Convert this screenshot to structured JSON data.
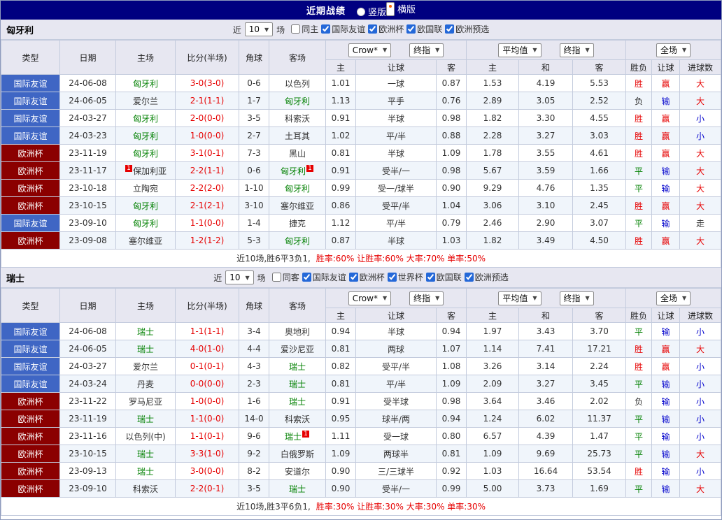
{
  "top_bar": {
    "title": "近期战绩",
    "options": [
      {
        "label": "竖版",
        "selected": false
      },
      {
        "label": "横版",
        "selected": true
      }
    ]
  },
  "table_header": {
    "type": "类型",
    "date": "日期",
    "home": "主场",
    "score": "比分(半场)",
    "corner": "角球",
    "away": "客场",
    "asia_select_1": "Crow*",
    "asia_select_2": "终指",
    "euro_select_1": "平均值",
    "euro_select_2": "终指",
    "scope_select": "全场",
    "asia_home": "主",
    "asia_handicap": "让球",
    "asia_away": "客",
    "euro_home": "主",
    "euro_draw": "和",
    "euro_away": "客",
    "res_outcome": "胜负",
    "res_handicap": "让球",
    "res_goals": "进球数"
  },
  "sections": [
    {
      "team": "匈牙利",
      "filter": {
        "prefix": "近",
        "count": "10",
        "suffix": "场",
        "checkboxes": [
          {
            "label": "同主",
            "checked": false
          },
          {
            "label": "国际友谊",
            "checked": true
          },
          {
            "label": "欧洲杯",
            "checked": true
          },
          {
            "label": "欧国联",
            "checked": true
          },
          {
            "label": "欧洲预选",
            "checked": true
          }
        ]
      },
      "rows": [
        {
          "type": "国际友谊",
          "typeColor": "blue",
          "date": "24-06-08",
          "home": "匈牙利",
          "homeHL": true,
          "homeCard": "",
          "score": "3-0(3-0)",
          "corner": "0-6",
          "away": "以色列",
          "awayHL": false,
          "awayCard": "",
          "asiaHome": "1.01",
          "handicap": "一球",
          "asiaAway": "0.87",
          "euroHome": "1.53",
          "euroDraw": "4.19",
          "euroAway": "5.53",
          "outcome": "胜",
          "outcomeC": "r",
          "letBall": "赢",
          "letBallC": "r",
          "goals": "大",
          "goalsC": "r"
        },
        {
          "type": "国际友谊",
          "typeColor": "blue",
          "date": "24-06-05",
          "home": "爱尔兰",
          "homeHL": false,
          "homeCard": "",
          "score": "2-1(1-1)",
          "corner": "1-7",
          "away": "匈牙利",
          "awayHL": true,
          "awayCard": "",
          "asiaHome": "1.13",
          "handicap": "平手",
          "asiaAway": "0.76",
          "euroHome": "2.89",
          "euroDraw": "3.05",
          "euroAway": "2.52",
          "outcome": "负",
          "outcomeC": "k",
          "letBall": "输",
          "letBallC": "b",
          "goals": "大",
          "goalsC": "r"
        },
        {
          "type": "国际友谊",
          "typeColor": "blue",
          "date": "24-03-27",
          "home": "匈牙利",
          "homeHL": true,
          "homeCard": "",
          "score": "2-0(0-0)",
          "corner": "3-5",
          "away": "科索沃",
          "awayHL": false,
          "awayCard": "",
          "asiaHome": "0.91",
          "handicap": "半球",
          "asiaAway": "0.98",
          "euroHome": "1.82",
          "euroDraw": "3.30",
          "euroAway": "4.55",
          "outcome": "胜",
          "outcomeC": "r",
          "letBall": "赢",
          "letBallC": "r",
          "goals": "小",
          "goalsC": "b"
        },
        {
          "type": "国际友谊",
          "typeColor": "blue",
          "date": "24-03-23",
          "home": "匈牙利",
          "homeHL": true,
          "homeCard": "",
          "score": "1-0(0-0)",
          "corner": "2-7",
          "away": "土耳其",
          "awayHL": false,
          "awayCard": "",
          "asiaHome": "1.02",
          "handicap": "平/半",
          "asiaAway": "0.88",
          "euroHome": "2.28",
          "euroDraw": "3.27",
          "euroAway": "3.03",
          "outcome": "胜",
          "outcomeC": "r",
          "letBall": "赢",
          "letBallC": "r",
          "goals": "小",
          "goalsC": "b"
        },
        {
          "type": "欧洲杯",
          "typeColor": "red",
          "date": "23-11-19",
          "home": "匈牙利",
          "homeHL": true,
          "homeCard": "",
          "score": "3-1(0-1)",
          "corner": "7-3",
          "away": "黑山",
          "awayHL": false,
          "awayCard": "",
          "asiaHome": "0.81",
          "handicap": "半球",
          "asiaAway": "1.09",
          "euroHome": "1.78",
          "euroDraw": "3.55",
          "euroAway": "4.61",
          "outcome": "胜",
          "outcomeC": "r",
          "letBall": "赢",
          "letBallC": "r",
          "goals": "大",
          "goalsC": "r"
        },
        {
          "type": "欧洲杯",
          "typeColor": "red",
          "date": "23-11-17",
          "home": "保加利亚",
          "homeHL": false,
          "homeCard": "1",
          "score": "2-2(1-1)",
          "corner": "0-6",
          "away": "匈牙利",
          "awayHL": true,
          "awayCard": "1",
          "asiaHome": "0.91",
          "handicap": "受半/一",
          "asiaAway": "0.98",
          "euroHome": "5.67",
          "euroDraw": "3.59",
          "euroAway": "1.66",
          "outcome": "平",
          "outcomeC": "g",
          "letBall": "输",
          "letBallC": "b",
          "goals": "大",
          "goalsC": "r"
        },
        {
          "type": "欧洲杯",
          "typeColor": "red",
          "date": "23-10-18",
          "home": "立陶宛",
          "homeHL": false,
          "homeCard": "",
          "score": "2-2(2-0)",
          "corner": "1-10",
          "away": "匈牙利",
          "awayHL": true,
          "awayCard": "",
          "asiaHome": "0.99",
          "handicap": "受一/球半",
          "asiaAway": "0.90",
          "euroHome": "9.29",
          "euroDraw": "4.76",
          "euroAway": "1.35",
          "outcome": "平",
          "outcomeC": "g",
          "letBall": "输",
          "letBallC": "b",
          "goals": "大",
          "goalsC": "r"
        },
        {
          "type": "欧洲杯",
          "typeColor": "red",
          "date": "23-10-15",
          "home": "匈牙利",
          "homeHL": true,
          "homeCard": "",
          "score": "2-1(2-1)",
          "corner": "3-10",
          "away": "塞尔维亚",
          "awayHL": false,
          "awayCard": "",
          "asiaHome": "0.86",
          "handicap": "受平/半",
          "asiaAway": "1.04",
          "euroHome": "3.06",
          "euroDraw": "3.10",
          "euroAway": "2.45",
          "outcome": "胜",
          "outcomeC": "r",
          "letBall": "赢",
          "letBallC": "r",
          "goals": "大",
          "goalsC": "r"
        },
        {
          "type": "国际友谊",
          "typeColor": "blue",
          "date": "23-09-10",
          "home": "匈牙利",
          "homeHL": true,
          "homeCard": "",
          "score": "1-1(0-0)",
          "corner": "1-4",
          "away": "捷克",
          "awayHL": false,
          "awayCard": "",
          "asiaHome": "1.12",
          "handicap": "平/半",
          "asiaAway": "0.79",
          "euroHome": "2.46",
          "euroDraw": "2.90",
          "euroAway": "3.07",
          "outcome": "平",
          "outcomeC": "g",
          "letBall": "输",
          "letBallC": "b",
          "goals": "走",
          "goalsC": "k"
        },
        {
          "type": "欧洲杯",
          "typeColor": "red",
          "date": "23-09-08",
          "home": "塞尔维亚",
          "homeHL": false,
          "homeCard": "",
          "score": "1-2(1-2)",
          "corner": "5-3",
          "away": "匈牙利",
          "awayHL": true,
          "awayCard": "",
          "asiaHome": "0.87",
          "handicap": "半球",
          "asiaAway": "1.03",
          "euroHome": "1.82",
          "euroDraw": "3.49",
          "euroAway": "4.50",
          "outcome": "胜",
          "outcomeC": "r",
          "letBall": "赢",
          "letBallC": "r",
          "goals": "大",
          "goalsC": "r"
        }
      ],
      "summary": {
        "prefix": "近10场,胜6平3负1,",
        "stats": "胜率:60% 让胜率:60% 大率:70% 单率:50%"
      }
    },
    {
      "team": "瑞士",
      "filter": {
        "prefix": "近",
        "count": "10",
        "suffix": "场",
        "checkboxes": [
          {
            "label": "同客",
            "checked": false
          },
          {
            "label": "国际友谊",
            "checked": true
          },
          {
            "label": "欧洲杯",
            "checked": true
          },
          {
            "label": "世界杯",
            "checked": true
          },
          {
            "label": "欧国联",
            "checked": true
          },
          {
            "label": "欧洲预选",
            "checked": true
          }
        ]
      },
      "rows": [
        {
          "type": "国际友谊",
          "typeColor": "blue",
          "date": "24-06-08",
          "home": "瑞士",
          "homeHL": true,
          "homeCard": "",
          "score": "1-1(1-1)",
          "corner": "3-4",
          "away": "奥地利",
          "awayHL": false,
          "awayCard": "",
          "asiaHome": "0.94",
          "handicap": "半球",
          "asiaAway": "0.94",
          "euroHome": "1.97",
          "euroDraw": "3.43",
          "euroAway": "3.70",
          "outcome": "平",
          "outcomeC": "g",
          "letBall": "输",
          "letBallC": "b",
          "goals": "小",
          "goalsC": "b"
        },
        {
          "type": "国际友谊",
          "typeColor": "blue",
          "date": "24-06-05",
          "home": "瑞士",
          "homeHL": true,
          "homeCard": "",
          "score": "4-0(1-0)",
          "corner": "4-4",
          "away": "爱沙尼亚",
          "awayHL": false,
          "awayCard": "",
          "asiaHome": "0.81",
          "handicap": "两球",
          "asiaAway": "1.07",
          "euroHome": "1.14",
          "euroDraw": "7.41",
          "euroAway": "17.21",
          "outcome": "胜",
          "outcomeC": "r",
          "letBall": "赢",
          "letBallC": "r",
          "goals": "大",
          "goalsC": "r"
        },
        {
          "type": "国际友谊",
          "typeColor": "blue",
          "date": "24-03-27",
          "home": "爱尔兰",
          "homeHL": false,
          "homeCard": "",
          "score": "0-1(0-1)",
          "corner": "4-3",
          "away": "瑞士",
          "awayHL": true,
          "awayCard": "",
          "asiaHome": "0.82",
          "handicap": "受平/半",
          "asiaAway": "1.08",
          "euroHome": "3.26",
          "euroDraw": "3.14",
          "euroAway": "2.24",
          "outcome": "胜",
          "outcomeC": "r",
          "letBall": "赢",
          "letBallC": "r",
          "goals": "小",
          "goalsC": "b"
        },
        {
          "type": "国际友谊",
          "typeColor": "blue",
          "date": "24-03-24",
          "home": "丹麦",
          "homeHL": false,
          "homeCard": "",
          "score": "0-0(0-0)",
          "corner": "2-3",
          "away": "瑞士",
          "awayHL": true,
          "awayCard": "",
          "asiaHome": "0.81",
          "handicap": "平/半",
          "asiaAway": "1.09",
          "euroHome": "2.09",
          "euroDraw": "3.27",
          "euroAway": "3.45",
          "outcome": "平",
          "outcomeC": "g",
          "letBall": "输",
          "letBallC": "b",
          "goals": "小",
          "goalsC": "b"
        },
        {
          "type": "欧洲杯",
          "typeColor": "red",
          "date": "23-11-22",
          "home": "罗马尼亚",
          "homeHL": false,
          "homeCard": "",
          "score": "1-0(0-0)",
          "corner": "1-6",
          "away": "瑞士",
          "awayHL": true,
          "awayCard": "",
          "asiaHome": "0.91",
          "handicap": "受半球",
          "asiaAway": "0.98",
          "euroHome": "3.64",
          "euroDraw": "3.46",
          "euroAway": "2.02",
          "outcome": "负",
          "outcomeC": "k",
          "letBall": "输",
          "letBallC": "b",
          "goals": "小",
          "goalsC": "b"
        },
        {
          "type": "欧洲杯",
          "typeColor": "red",
          "date": "23-11-19",
          "home": "瑞士",
          "homeHL": true,
          "homeCard": "",
          "score": "1-1(0-0)",
          "corner": "14-0",
          "away": "科索沃",
          "awayHL": false,
          "awayCard": "",
          "asiaHome": "0.95",
          "handicap": "球半/两",
          "asiaAway": "0.94",
          "euroHome": "1.24",
          "euroDraw": "6.02",
          "euroAway": "11.37",
          "outcome": "平",
          "outcomeC": "g",
          "letBall": "输",
          "letBallC": "b",
          "goals": "小",
          "goalsC": "b"
        },
        {
          "type": "欧洲杯",
          "typeColor": "red",
          "date": "23-11-16",
          "home": "以色列(中)",
          "homeHL": false,
          "homeCard": "",
          "score": "1-1(0-1)",
          "corner": "9-6",
          "away": "瑞士",
          "awayHL": true,
          "awayCard": "1",
          "asiaHome": "1.11",
          "handicap": "受一球",
          "asiaAway": "0.80",
          "euroHome": "6.57",
          "euroDraw": "4.39",
          "euroAway": "1.47",
          "outcome": "平",
          "outcomeC": "g",
          "letBall": "输",
          "letBallC": "b",
          "goals": "小",
          "goalsC": "b"
        },
        {
          "type": "欧洲杯",
          "typeColor": "red",
          "date": "23-10-15",
          "home": "瑞士",
          "homeHL": true,
          "homeCard": "",
          "score": "3-3(1-0)",
          "corner": "9-2",
          "away": "白俄罗斯",
          "awayHL": false,
          "awayCard": "",
          "asiaHome": "1.09",
          "handicap": "两球半",
          "asiaAway": "0.81",
          "euroHome": "1.09",
          "euroDraw": "9.69",
          "euroAway": "25.73",
          "outcome": "平",
          "outcomeC": "g",
          "letBall": "输",
          "letBallC": "b",
          "goals": "大",
          "goalsC": "r"
        },
        {
          "type": "欧洲杯",
          "typeColor": "red",
          "date": "23-09-13",
          "home": "瑞士",
          "homeHL": true,
          "homeCard": "",
          "score": "3-0(0-0)",
          "corner": "8-2",
          "away": "安道尔",
          "awayHL": false,
          "awayCard": "",
          "asiaHome": "0.90",
          "handicap": "三/三球半",
          "asiaAway": "0.92",
          "euroHome": "1.03",
          "euroDraw": "16.64",
          "euroAway": "53.54",
          "outcome": "胜",
          "outcomeC": "r",
          "letBall": "输",
          "letBallC": "b",
          "goals": "小",
          "goalsC": "b"
        },
        {
          "type": "欧洲杯",
          "typeColor": "red",
          "date": "23-09-10",
          "home": "科索沃",
          "homeHL": false,
          "homeCard": "",
          "score": "2-2(0-1)",
          "corner": "3-5",
          "away": "瑞士",
          "awayHL": true,
          "awayCard": "",
          "asiaHome": "0.90",
          "handicap": "受半/一",
          "asiaAway": "0.99",
          "euroHome": "5.00",
          "euroDraw": "3.73",
          "euroAway": "1.69",
          "outcome": "平",
          "outcomeC": "g",
          "letBall": "输",
          "letBallC": "b",
          "goals": "大",
          "goalsC": "r"
        }
      ],
      "summary": {
        "prefix": "近10场,胜3平6负1,",
        "stats": "胜率:30% 让胜率:30% 大率:30% 单率:30%"
      }
    }
  ]
}
